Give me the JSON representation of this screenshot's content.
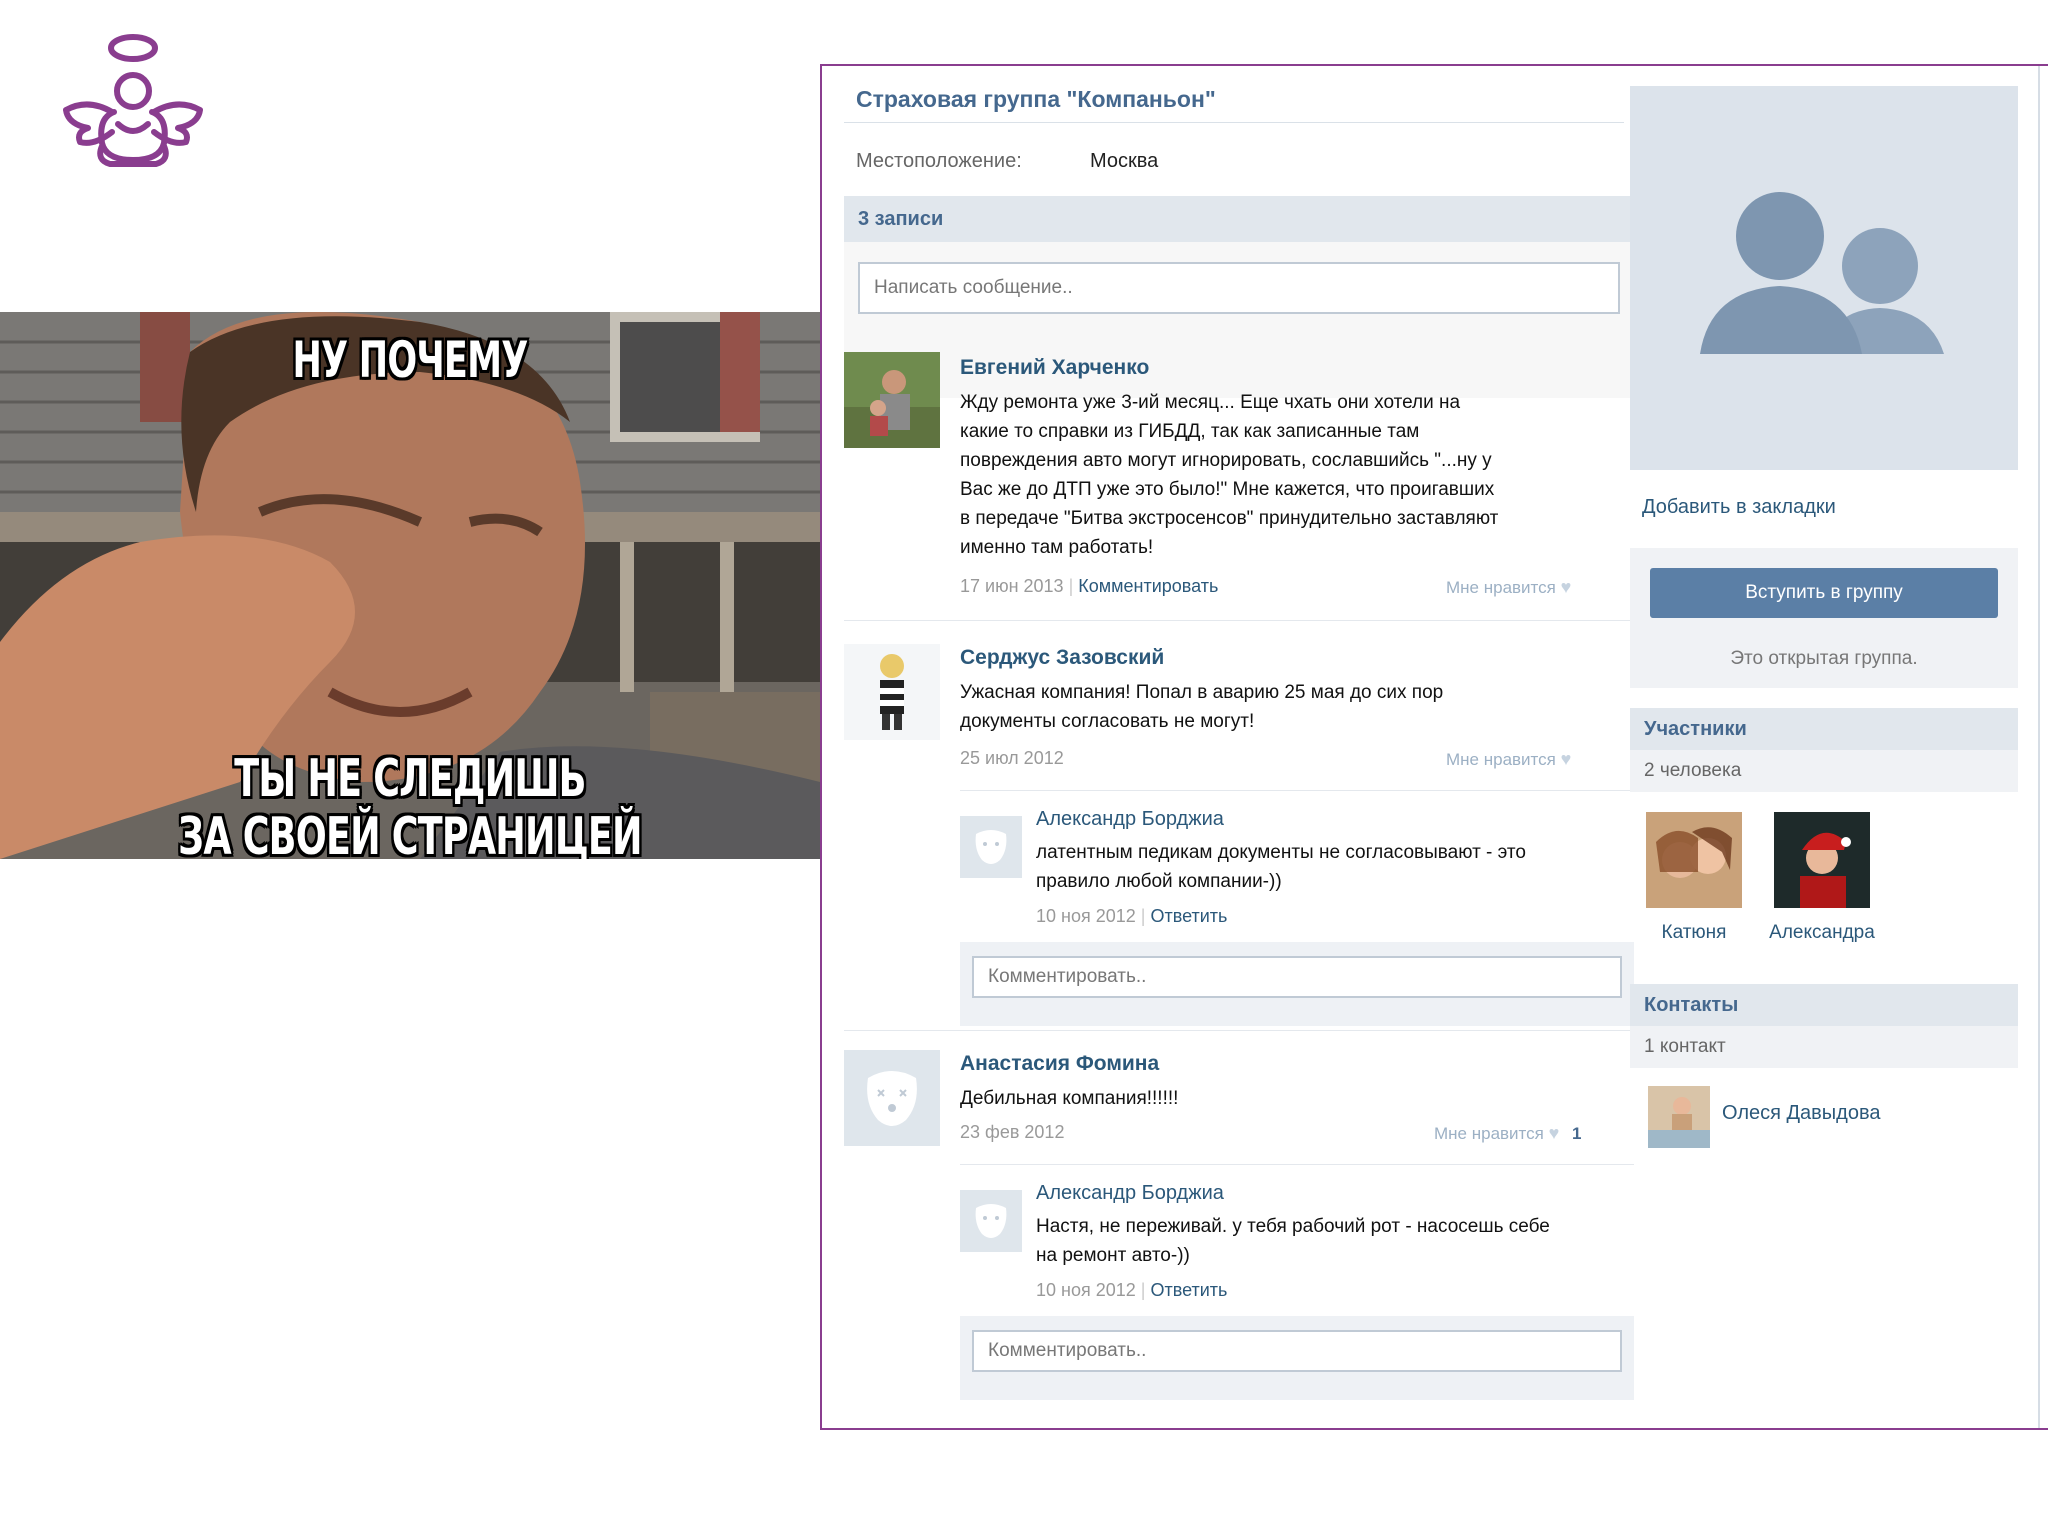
{
  "meme": {
    "top_text": "НУ ПОЧЕМУ",
    "bottom_line1": "ТЫ НЕ СЛЕДИШЬ",
    "bottom_line2": "ЗА СВОЕЙ СТРАНИЦЕЙ ВКОНТАКТЕ?"
  },
  "group": {
    "title": "Страховая группа \"Компаньон\"",
    "location_label": "Местоположение:",
    "location_value": "Москва"
  },
  "wall": {
    "count_label": "3 записи",
    "post_placeholder": "Написать сообщение..",
    "posts": [
      {
        "author": "Евгений Харченко",
        "lines": [
          "Жду ремонта уже 3-ий месяц... Еще чхать они хотели на",
          "какие то справки из ГИБДД, так как записанные там",
          "повреждения авто могут игнорировать, сославшийсь \"...ну у",
          "Вас же до ДТП уже это было!\" Мне кажется, что проигавших",
          "в передаче \"Битва экстросенсов\" принудительно заставляют",
          "именно там работать!"
        ],
        "date": "17 июн 2013",
        "action": "Комментировать",
        "like_label": "Мне нравится"
      },
      {
        "author": "Серджус Зазовский",
        "lines": [
          "Ужасная компания! Попал в аварию 25 мая до сих пор",
          "документы согласовать не могут!"
        ],
        "date": "25 июл 2012",
        "like_label": "Мне нравится",
        "reply": {
          "author": "Александр Борджиа",
          "lines": [
            "латентным педикам документы не согласовывают - это",
            "правило любой компании-))"
          ],
          "date": "10 ноя 2012",
          "action": "Ответить"
        },
        "comment_placeholder": "Комментировать.."
      },
      {
        "author": "Анастасия Фомина",
        "lines": [
          "Дебильная компания!!!!!!"
        ],
        "date": "23 фев 2012",
        "like_label": "Мне нравится",
        "like_count": "1",
        "reply": {
          "author": "Александр Борджиа",
          "lines": [
            "Настя, не переживай. у тебя рабочий рот - насосешь себе",
            "на ремонт авто-))"
          ],
          "date": "10 ноя 2012",
          "action": "Ответить"
        },
        "comment_placeholder": "Комментировать.."
      }
    ]
  },
  "sidebar": {
    "bookmark": "Добавить в закладки",
    "join_button": "Вступить в группу",
    "open_group_note": "Это открытая группа.",
    "members_title": "Участники",
    "members_count": "2 человека",
    "members": [
      "Катюня",
      "Александра"
    ],
    "contacts_title": "Контакты",
    "contacts_count": "1 контакт",
    "contact_name": "Олеся Давыдова"
  },
  "colors": {
    "brand_purple": "#8a3d8f",
    "vk_link": "#2b587a",
    "vk_header": "#45688e",
    "button": "#5b7fa6"
  }
}
